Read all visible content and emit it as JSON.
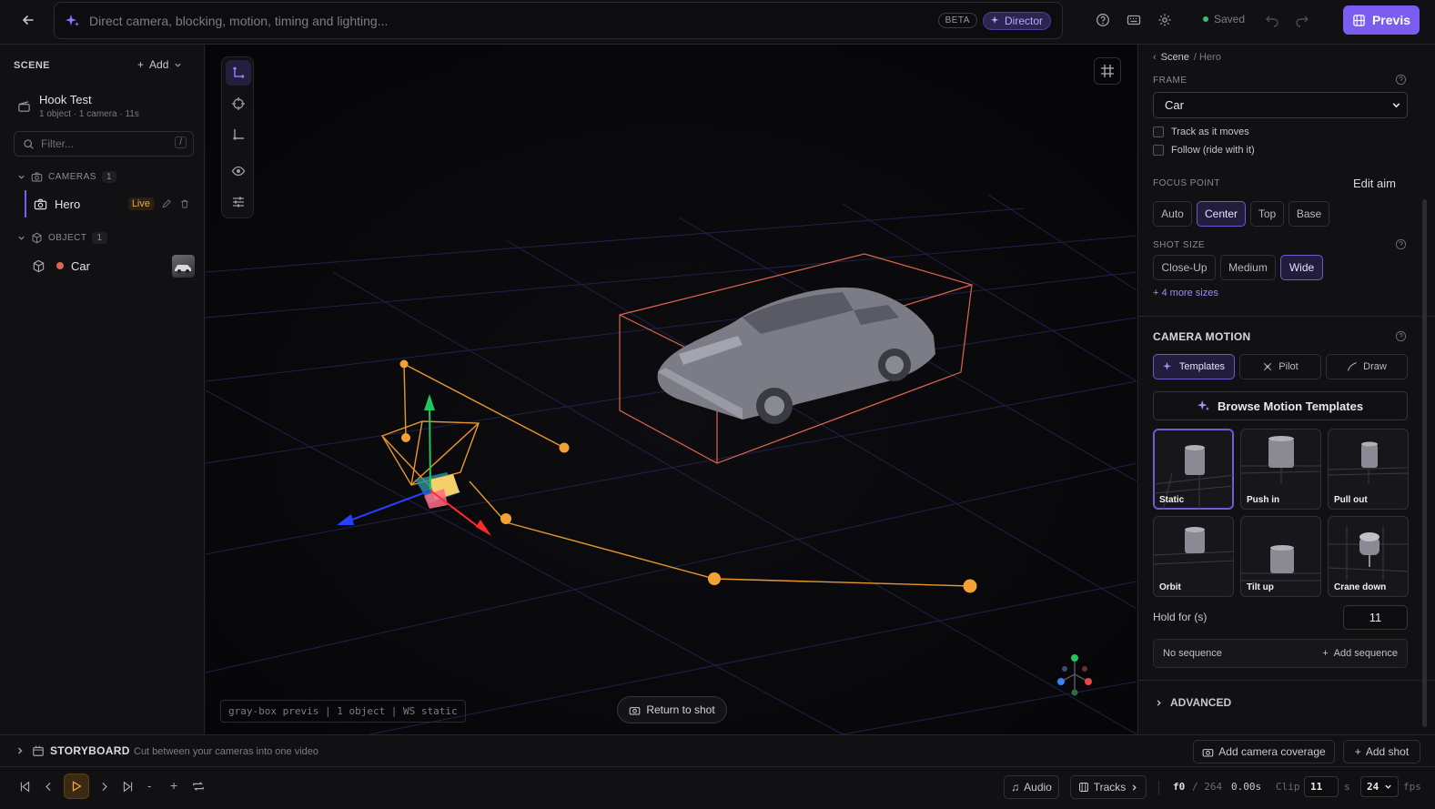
{
  "topbar": {
    "prompt_placeholder": "Direct camera, blocking, motion, timing and lighting...",
    "beta_label": "BETA",
    "director_label": "Director",
    "saved_label": "Saved",
    "previs_label": "Previs"
  },
  "scene_panel": {
    "title": "SCENE",
    "add_label": "Add",
    "project_name": "Hook Test",
    "project_meta": "1 object · 1 camera · 11s",
    "filter_placeholder": "Filter...",
    "filter_shortcut": "/",
    "cameras_header": "CAMERAS",
    "cameras_count": "1",
    "camera_name": "Hero",
    "camera_status": "Live",
    "object_header": "OBJECT",
    "object_count": "1",
    "object_name": "Car",
    "object_color": "#e0644f"
  },
  "viewport": {
    "hud_text": "gray-box previs | 1 object | WS static",
    "return_label": "Return to shot"
  },
  "inspector": {
    "breadcrumb_root": "Scene",
    "breadcrumb_current": "/ Hero",
    "frame_label": "FRAME",
    "frame_value": "Car",
    "track_label": "Track as it moves",
    "follow_label": "Follow (ride with it)",
    "focus_label": "FOCUS POINT",
    "edit_aim_label": "Edit aim",
    "focus_options": [
      "Auto",
      "Center",
      "Top",
      "Base"
    ],
    "focus_selected": "Center",
    "shot_size_label": "SHOT SIZE",
    "shot_sizes": [
      "Close-Up",
      "Medium",
      "Wide"
    ],
    "shot_size_selected": "Wide",
    "more_sizes": "+ 4 more sizes",
    "camera_motion_label": "CAMERA MOTION",
    "motion_tabs": [
      "Templates",
      "Pilot",
      "Draw"
    ],
    "browse_label": "Browse Motion Templates",
    "templates": [
      "Static",
      "Push in",
      "Pull out",
      "Orbit",
      "Tilt up",
      "Crane down"
    ],
    "template_selected": "Static",
    "hold_label": "Hold for (s)",
    "hold_value": "11",
    "sequence_label": "No sequence",
    "add_sequence_label": "Add sequence",
    "advanced_label": "ADVANCED",
    "accent": "#7a5cf0"
  },
  "storyboard": {
    "title": "STORYBOARD",
    "subtitle": "Cut between your cameras into one video",
    "add_coverage_label": "Add camera coverage",
    "add_shot_label": "Add shot"
  },
  "timeline": {
    "minus_label": "-",
    "plus_label": "+",
    "audio_label": "Audio",
    "tracks_label": "Tracks",
    "frame_current": "f0",
    "frame_total": "/ 264",
    "time": "0.00s",
    "clip_label": "Clip",
    "clip_value": "11",
    "clip_unit": "s",
    "fps_value": "24",
    "fps_label": "fps"
  }
}
